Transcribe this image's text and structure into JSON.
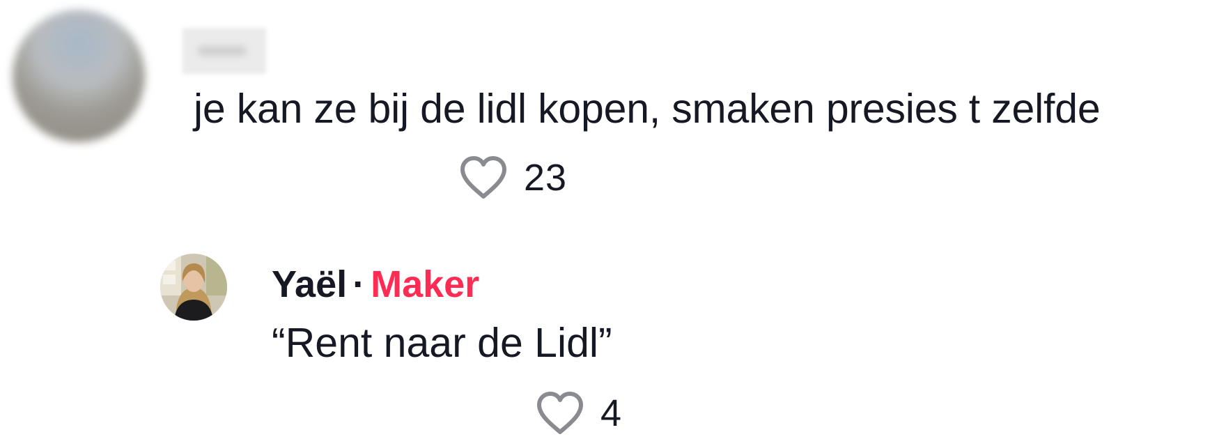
{
  "comment": {
    "text": "je kan ze bij de lidl kopen, smaken presies t zelfde",
    "like_count": "23",
    "avatar_icon": "blurred-avatar",
    "username_icon": "blurred-username"
  },
  "reply": {
    "username": "Yaël",
    "separator": "·",
    "badge": "Maker",
    "text": "“Rent naar de Lidl”",
    "like_count": "4",
    "avatar_icon": "profile-photo"
  },
  "icons": {
    "like": "heart-icon"
  },
  "colors": {
    "text": "#161823",
    "creator_badge": "#fe2c55",
    "heart_outline": "#8a8b91",
    "background": "#ffffff"
  }
}
